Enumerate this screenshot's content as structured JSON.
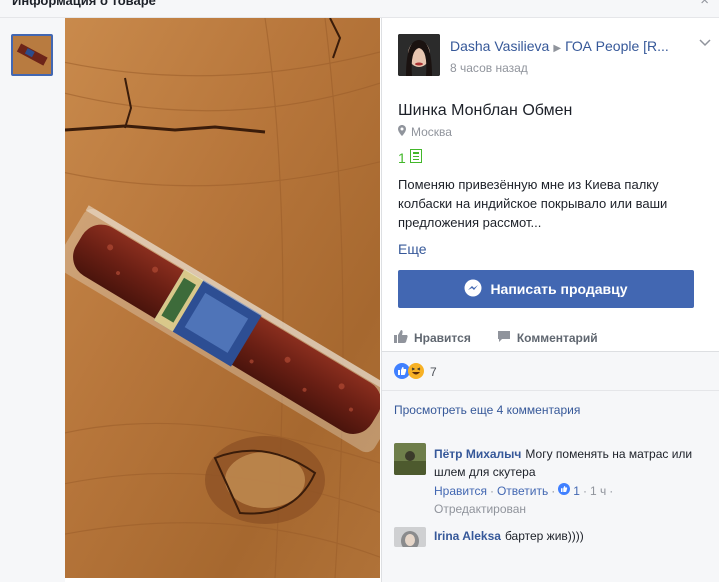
{
  "dialog": {
    "title": "Информация о товаре",
    "close_symbol": "×"
  },
  "seller": {
    "name": "Dasha Vasilieva",
    "group": "ГОА People [R...",
    "time": "8 часов назад"
  },
  "item": {
    "title": "Шинка Монблан Обмен",
    "location": "Москва",
    "price": "1",
    "description": "Поменяю привезённую мне из Киева палку колбаски на индийское покрывало или ваши предложения рассмот...",
    "more_label": "Еще"
  },
  "message_button": {
    "label": "Написать продавцу"
  },
  "actions": {
    "like": "Нравится",
    "comment": "Комментарий"
  },
  "reactions": {
    "types": [
      "like-icon",
      "haha-icon"
    ],
    "count": "7"
  },
  "comments": {
    "view_more": "Просмотреть еще 4 комментария",
    "items": [
      {
        "author": "Пётр Михалыч",
        "text": "Могу поменять на матрас или шлем для скутера",
        "like_label": "Нравится",
        "reply_label": "Ответить",
        "likes": "1",
        "time": "1 ч",
        "edited": "Отредактирован"
      },
      {
        "author": "Irina Aleksa",
        "text": "бартер жив))))"
      }
    ]
  },
  "colors": {
    "accent": "#4267b2",
    "link": "#365899",
    "price": "#42b72a",
    "muted": "#90949c"
  }
}
